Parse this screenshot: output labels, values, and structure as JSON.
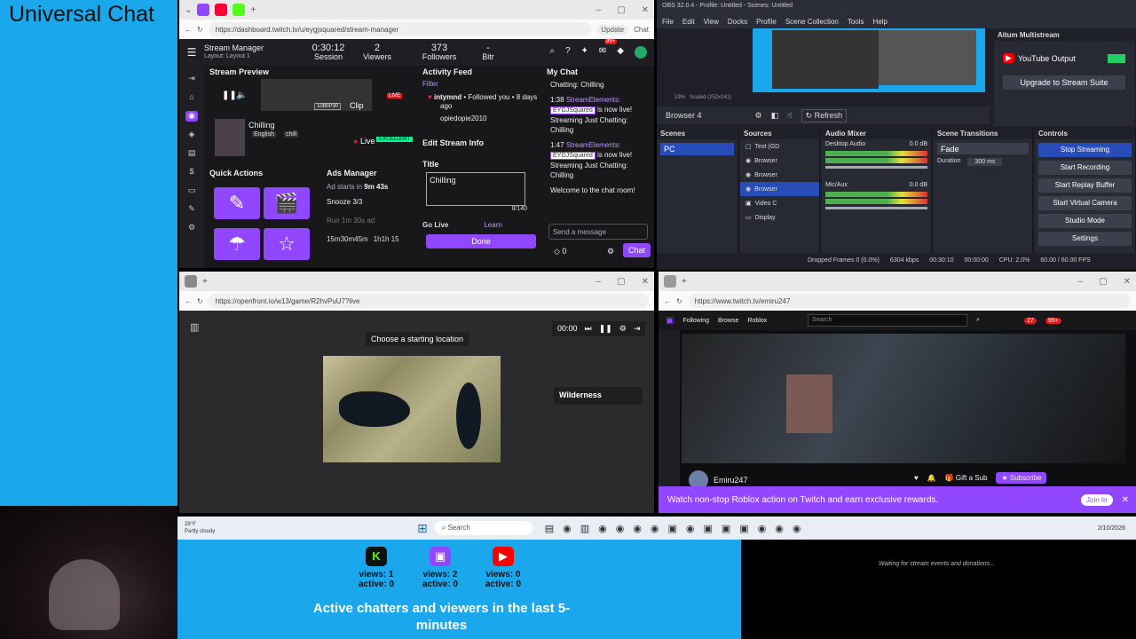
{
  "overlay": {
    "title": "Universal Chat"
  },
  "dashboard": {
    "url": "https://dashboard.twitch.tv/u/eygjsquared/stream-manager",
    "update_label": "Update",
    "chat_label": "Chat",
    "stream_manager": "Stream Manager",
    "layout": "Layout: Layout 1",
    "session_value": "0:30:12",
    "session_label": "Session",
    "viewers_value": "2",
    "viewers_label": "Viewers",
    "followers_value": "373",
    "followers_label": "Followers",
    "bitrate_label": "Bitr",
    "badge": "99+",
    "stream_preview": "Stream Preview",
    "quality": "1080P30",
    "clip_label": "Clip",
    "live_badge": "LIVE",
    "stream_title": "Chilling",
    "stream_lang": "English",
    "stream_tag": "chill",
    "live_label": "Live",
    "excellent": "EXCELLENT",
    "quick_actions": "Quick Actions",
    "ads_manager": "Ads Manager",
    "ad_starts": "Ad starts in",
    "ad_time": "9m 43s",
    "snooze": "Snooze 3/3",
    "run_ad": "Run 1m 30s ad",
    "ad_timer1": "15m30m45m",
    "ad_timer2": "1h1h 15",
    "activity_feed": "Activity Feed",
    "filter": "Filter",
    "activity_user": "intymnd",
    "activity_action": "• Followed you • 8 days ago",
    "activity_user2": "opiedopie2010",
    "edit_stream_info": "Edit Stream Info",
    "title_label": "Title",
    "title_value": "Chilling",
    "title_count": "8/140",
    "go_live": "Go Live",
    "learn": "Learn",
    "done": "Done",
    "my_chat": "My Chat",
    "chat_lines": [
      {
        "text": "Chatting: Chilling"
      },
      {
        "time": "1:38",
        "user": "StreamElements:",
        "tag": "EYGJSquared",
        "msg": "is now live! Streaming Just Chatting: Chilling"
      },
      {
        "time": "1:47",
        "user": "StreamElements:",
        "tag": "EYGJSquared",
        "msg": "is now live! Streaming Just Chatting: Chilling"
      }
    ],
    "welcome": "Welcome to the chat room!",
    "send_placeholder": "Send a message",
    "points": "0",
    "chat_button": "Chat"
  },
  "obs": {
    "title": "OBS 32.0.4 - Profile: Untitled - Scenes: Untitled",
    "menu": [
      "File",
      "Edit",
      "View",
      "Docks",
      "Profile",
      "Scene Collection",
      "Tools",
      "Help"
    ],
    "zoom": "19%",
    "scaled": "Scaled (252x141)",
    "selected_source": "Browser 4",
    "refresh": "Refresh",
    "aitum_title": "Aitum Multistream",
    "youtube": "YouTube Output",
    "upgrade": "Upgrade to Stream Suite",
    "docks": {
      "scenes": "Scenes",
      "sources": "Sources",
      "mixer": "Audio Mixer",
      "transitions": "Scene Transitions",
      "controls": "Controls"
    },
    "scene_item": "PC",
    "sources": [
      "Text (GD",
      "Browser",
      "Browser",
      "Browser",
      "Video C",
      "Display"
    ],
    "mixer_tracks": [
      {
        "name": "Desktop Audio",
        "db": "0.0 dB"
      },
      {
        "name": "Mic/Aux",
        "db": "0.0 dB"
      }
    ],
    "transition": "Fade",
    "duration_label": "Duration",
    "duration_value": "300 ms",
    "controls": [
      "Stop Streaming",
      "Start Recording",
      "Start Replay Buffer",
      "Start Virtual Camera",
      "Studio Mode",
      "Settings"
    ],
    "status": {
      "dropped": "Dropped Frames 0 (0.0%)",
      "kbps": "6304 kbps",
      "live": "00:30:10",
      "rec": "00:00:00",
      "cpu": "CPU: 2.0%",
      "fps": "60.00 / 60.00 FPS"
    }
  },
  "openfront": {
    "url": "https://openfront.io/w13/game/R2hvPuU7?live",
    "prompt": "Choose a starting location",
    "timer": "00:00",
    "terrain": "Wilderness"
  },
  "viewer": {
    "url": "https://www.twitch.tv/emiru247",
    "nav": [
      "Following",
      "Browse",
      "Roblox"
    ],
    "search_placeholder": "Search",
    "notif_count": "27",
    "msg_count": "99+",
    "channel": "Emiru247",
    "gift": "Gift a Sub",
    "subscribe": "Subscribe",
    "banner": "Watch non-stop Roblox action on Twitch and earn exclusive rewards.",
    "join": "Join In"
  },
  "taskbar": {
    "weather_temp": "28°F",
    "weather_desc": "Partly cloudy",
    "search": "Search",
    "time": "",
    "date": "2/10/2026"
  },
  "viewers_widget": {
    "platforms": [
      {
        "icon": "K",
        "views": "views: 1",
        "active": "active: 0",
        "color": "#53fc18"
      },
      {
        "icon": "▣",
        "views": "views: 2",
        "active": "active: 0",
        "color": "#9147ff"
      },
      {
        "icon": "▶",
        "views": "views: 0",
        "active": "active: 0",
        "color": "#ff0000"
      }
    ],
    "caption": "Active chatters and viewers in the last 5-minutes"
  },
  "events_widget": {
    "waiting": "Waiting for stream events and donations..."
  }
}
